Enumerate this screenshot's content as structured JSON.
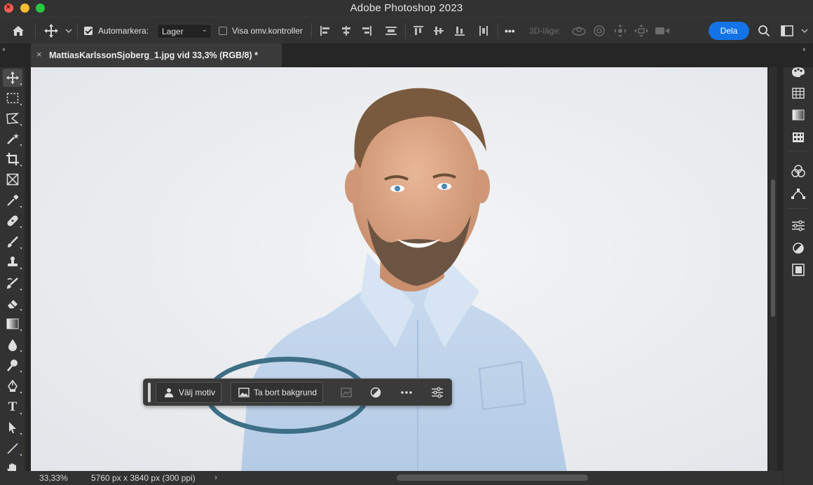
{
  "window": {
    "title": "Adobe Photoshop 2023",
    "traffic_lights": {
      "close": "#fe5f57",
      "minimize": "#febc2e",
      "zoom": "#28c840"
    }
  },
  "options_bar": {
    "home_icon": "home-icon",
    "move_tool_icon": "move-tool-icon",
    "auto_select_label": "Automarkera:",
    "auto_select_checked": true,
    "layer_select_value": "Lager",
    "show_transform_label": "Visa omv.kontroller",
    "show_transform_checked": false,
    "more_label": "•••",
    "mode_3d_label": "3D-läge:",
    "share_label": "Dela",
    "share_color": "#1473e6"
  },
  "document_tab": {
    "title": "MattiasKarlssonSjoberg_1.jpg vid 33,3% (RGB/8) *",
    "close_label": "×"
  },
  "toolbar": {
    "tools": [
      {
        "name": "move-tool-icon",
        "active": true
      },
      {
        "name": "marquee-tool-icon"
      },
      {
        "name": "lasso-tool-icon"
      },
      {
        "name": "magic-wand-tool-icon"
      },
      {
        "name": "crop-tool-icon"
      },
      {
        "name": "frame-tool-icon"
      },
      {
        "name": "eyedropper-tool-icon"
      },
      {
        "name": "healing-brush-tool-icon"
      },
      {
        "name": "brush-tool-icon"
      },
      {
        "name": "clone-stamp-tool-icon"
      },
      {
        "name": "history-brush-tool-icon"
      },
      {
        "name": "eraser-tool-icon"
      },
      {
        "name": "gradient-tool-icon"
      },
      {
        "name": "blur-tool-icon"
      },
      {
        "name": "dodge-tool-icon"
      },
      {
        "name": "pen-tool-icon"
      },
      {
        "name": "type-tool-icon",
        "glyph": "T"
      },
      {
        "name": "path-selection-tool-icon"
      },
      {
        "name": "line-tool-icon"
      },
      {
        "name": "hand-tool-icon"
      }
    ]
  },
  "contextual_task_bar": {
    "select_subject_label": "Välj motiv",
    "remove_background_label": "Ta bort bakgrund",
    "highlight_color": "#3d6f86"
  },
  "right_panel": {
    "icons": [
      "color-palette-icon",
      "swatches-grid-icon",
      "gradients-icon",
      "patterns-icon",
      "channels-icon",
      "paths-icon",
      "adjustments-icon",
      "adjustment-circle-icon",
      "libraries-icon"
    ]
  },
  "status_bar": {
    "zoom": "33,33%",
    "doc_info": "5760 px x 3840 px (300 ppi)",
    "arrow": "›"
  },
  "collapse_left": "››",
  "collapse_right": "‹‹"
}
